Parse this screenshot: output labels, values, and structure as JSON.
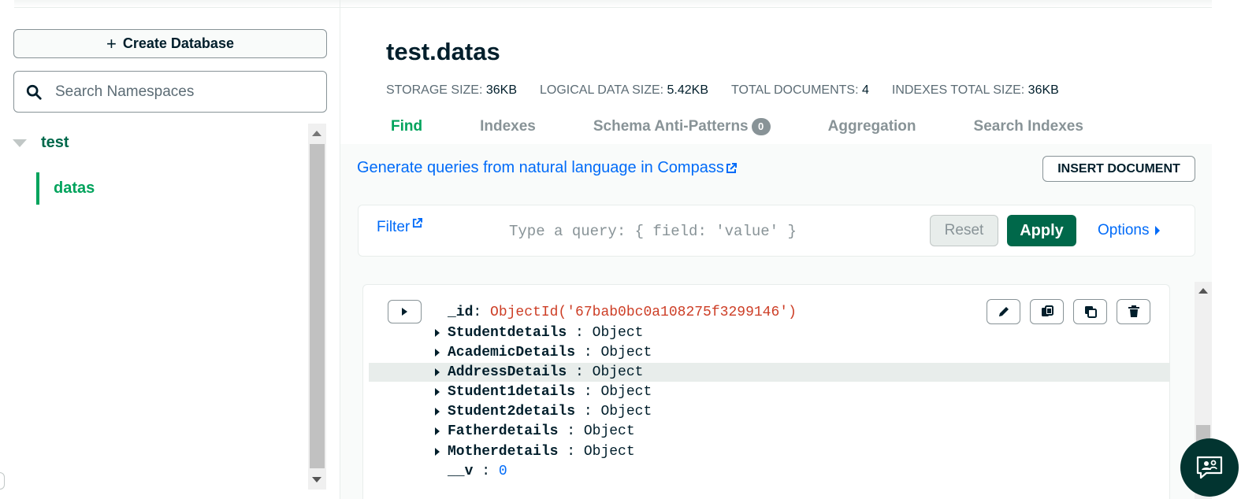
{
  "sidebar": {
    "create_database_label": "Create Database",
    "search_placeholder": "Search Namespaces",
    "database_name": "test",
    "collection_name": "datas"
  },
  "header": {
    "namespace": "test.datas",
    "stats": [
      {
        "label": "STORAGE SIZE:",
        "value": "36KB"
      },
      {
        "label": "LOGICAL DATA SIZE:",
        "value": "5.42KB"
      },
      {
        "label": "TOTAL DOCUMENTS:",
        "value": "4"
      },
      {
        "label": "INDEXES TOTAL SIZE:",
        "value": "36KB"
      }
    ],
    "tabs": [
      {
        "label": "Find",
        "active": true
      },
      {
        "label": "Indexes"
      },
      {
        "label": "Schema Anti-Patterns",
        "badge": "0"
      },
      {
        "label": "Aggregation"
      },
      {
        "label": "Search Indexes"
      }
    ]
  },
  "toolbar": {
    "compass_link": "Generate queries from natural language in Compass",
    "insert_label": "INSERT DOCUMENT"
  },
  "filter": {
    "label": "Filter",
    "placeholder": "Type a query: { field: 'value' }",
    "reset_label": "Reset",
    "apply_label": "Apply",
    "options_label": "Options"
  },
  "document": {
    "id_key": "_id",
    "id_value": "ObjectId('67bab0bc0a108275f3299146')",
    "fields": [
      {
        "key": "Studentdetails",
        "value": "Object"
      },
      {
        "key": "AcademicDetails",
        "value": "Object"
      },
      {
        "key": "AddressDetails",
        "value": "Object"
      },
      {
        "key": "Student1details",
        "value": "Object"
      },
      {
        "key": "Student2details",
        "value": "Object"
      },
      {
        "key": "Fatherdetails",
        "value": "Object"
      },
      {
        "key": "Motherdetails",
        "value": "Object"
      }
    ],
    "v_key": "__v",
    "v_value": "0"
  },
  "colors": {
    "brand_green": "#00684a",
    "accent_green": "#00a35c",
    "link_blue": "#016bf8",
    "objectid_red": "#cd3e26"
  }
}
